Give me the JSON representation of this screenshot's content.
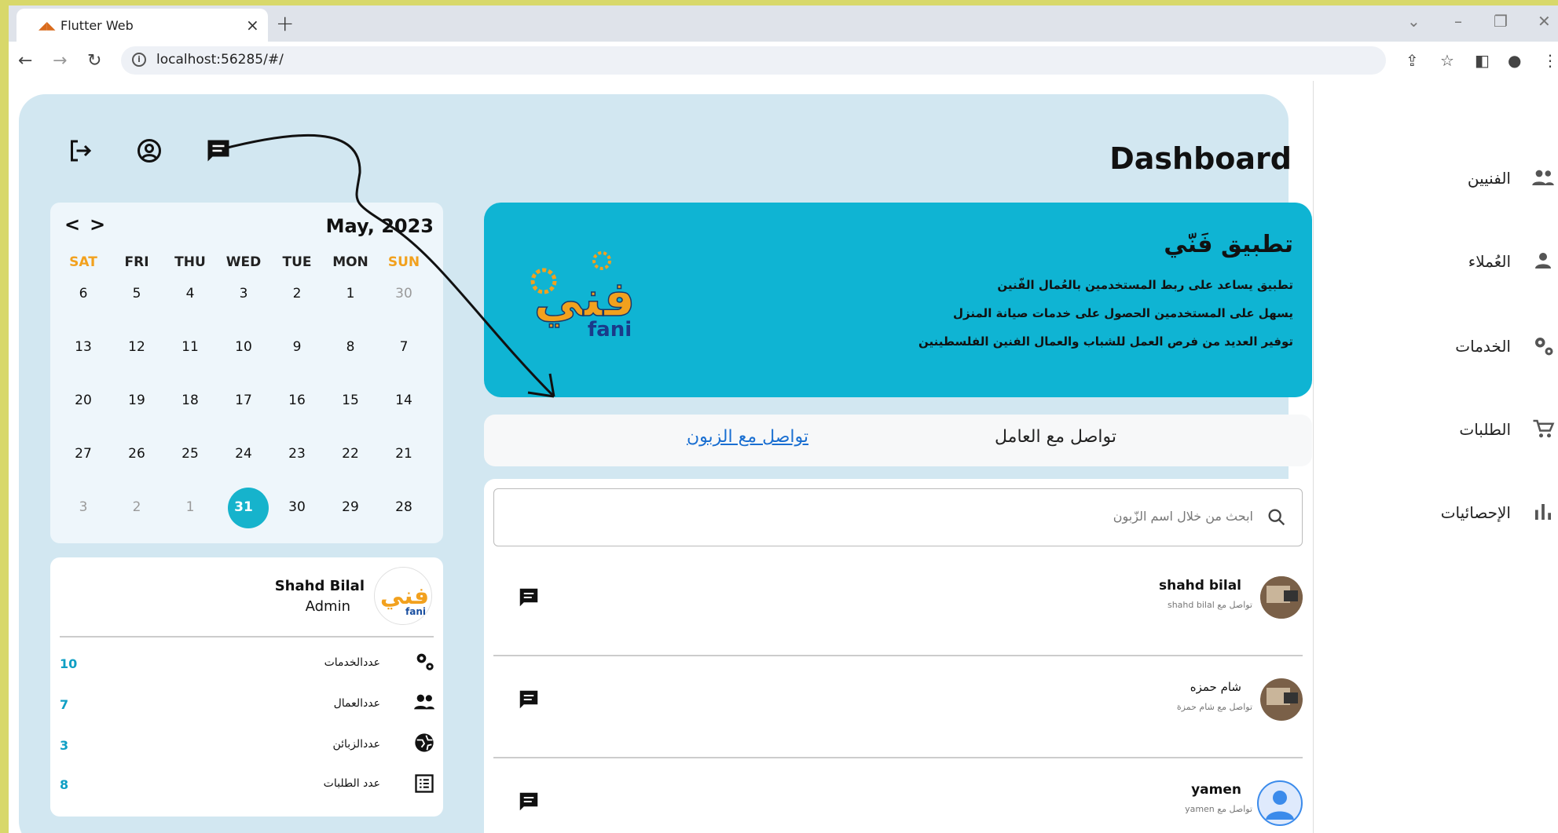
{
  "browser": {
    "tab_title": "Flutter Web",
    "tab_close": "×",
    "new_tab": "+",
    "url": "localhost:56285/#/",
    "controls": {
      "minimize": "–",
      "restore": "❐",
      "close": "✕",
      "tab_search": "⌄"
    }
  },
  "sidebar": {
    "items": [
      {
        "label": "الفنيين",
        "icon": "people-icon"
      },
      {
        "label": "العُملاء",
        "icon": "person-icon"
      },
      {
        "label": "الخدمات",
        "icon": "gears-icon"
      },
      {
        "label": "الطلبات",
        "icon": "cart-icon"
      },
      {
        "label": "الإحصائيات",
        "icon": "bar-chart-icon"
      }
    ]
  },
  "dashboard": {
    "title": "Dashboard"
  },
  "calendar": {
    "month_label": "May, 2023",
    "weekdays": [
      "SAT",
      "FRI",
      "THU",
      "WED",
      "TUE",
      "MON",
      "SUN"
    ],
    "weeks": [
      [
        "6",
        "5",
        "4",
        "3",
        "2",
        "1",
        "30"
      ],
      [
        "13",
        "12",
        "11",
        "10",
        "9",
        "8",
        "7"
      ],
      [
        "20",
        "19",
        "18",
        "17",
        "16",
        "15",
        "14"
      ],
      [
        "27",
        "26",
        "25",
        "24",
        "23",
        "22",
        "21"
      ],
      [
        "3",
        "2",
        "1",
        "31",
        "30",
        "29",
        "28"
      ]
    ],
    "today": "31",
    "prev": "<",
    "next": ">"
  },
  "profile": {
    "name": "Shahd Bilal",
    "role": "Admin",
    "stats": [
      {
        "label": "عددالخدمات",
        "value": "10",
        "icon": "gears-icon"
      },
      {
        "label": "عددالعمال",
        "value": "7",
        "icon": "people-icon"
      },
      {
        "label": "عددالزبائن",
        "value": "3",
        "icon": "globe-icon"
      },
      {
        "label": "عدد الطلبات",
        "value": "8",
        "icon": "list-icon"
      }
    ]
  },
  "banner": {
    "title": "تطبيق فَنّي",
    "lines": [
      "تطبيق يساعد على ربط المستخدمين بالعُمال الفّنين",
      "يسهل على المستخدمين الحصول على خدمات صيانة المنزل",
      "توفير العديد من فرص العمل للشباب والعمال الفنين الفلسطينين"
    ],
    "logo_text": "فني",
    "logo_sub": "fani"
  },
  "chat": {
    "tab_worker": "تواصل مع العامل",
    "tab_customer": "تواصل مع الزبون",
    "search_placeholder": "ابحث من خلال اسم الزّبون",
    "rows": [
      {
        "name": "shahd bilal",
        "sub": "تواصل مع shahd bilal"
      },
      {
        "name": "شام حمزه",
        "sub": "تواصل مع شام حمزة"
      },
      {
        "name": "yamen",
        "sub": "تواصل مع yamen"
      }
    ]
  },
  "colors": {
    "accent": "#16b3cc",
    "banner": "#0fb4d3",
    "panel": "#d2e7f1",
    "weekend": "#f2a11e",
    "link": "#1a6fd1"
  }
}
